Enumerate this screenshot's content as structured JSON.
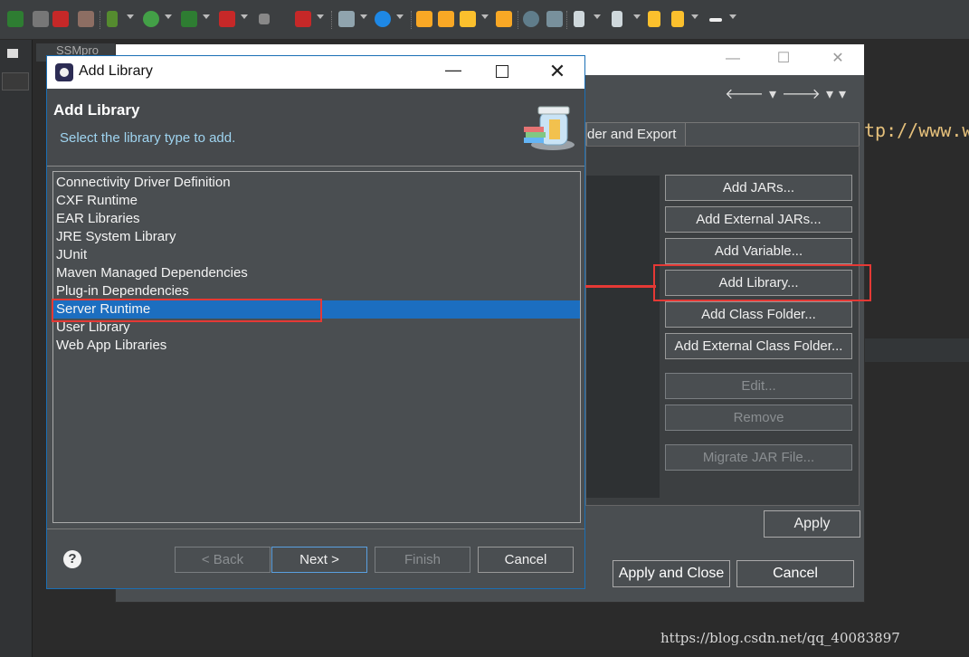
{
  "props": {
    "tab_label": "der and Export",
    "buttons": {
      "add_jars": "Add JARs...",
      "add_external_jars": "Add External JARs...",
      "add_variable": "Add Variable...",
      "add_library": "Add Library...",
      "add_class_folder": "Add Class Folder...",
      "add_external_class_folder": "Add External Class Folder...",
      "edit": "Edit...",
      "remove": "Remove",
      "migrate_jar": "Migrate JAR File..."
    },
    "apply": "Apply",
    "apply_and_close": "Apply and Close",
    "cancel": "Cancel"
  },
  "editor": {
    "tab_label": "SSMpro",
    "code_fragment": "tp://www.w"
  },
  "dialog": {
    "title": "Add Library",
    "heading": "Add Library",
    "subtitle": "Select the library type to add.",
    "libraries": [
      "Connectivity Driver Definition",
      "CXF Runtime",
      "EAR Libraries",
      "JRE System Library",
      "JUnit",
      "Maven Managed Dependencies",
      "Plug-in Dependencies",
      "Server Runtime",
      "User Library",
      "Web App Libraries"
    ],
    "selected_library": "Server Runtime",
    "buttons": {
      "back": "< Back",
      "next": "Next >",
      "finish": "Finish",
      "cancel": "Cancel"
    },
    "help": "?"
  },
  "watermark": "https://blog.csdn.net/qq_40083897",
  "colors": {
    "selection": "#1c6ec0",
    "annotation_red": "#e53935",
    "dialog_bg": "#4a4e51",
    "hint_text": "#9fd4f0"
  }
}
